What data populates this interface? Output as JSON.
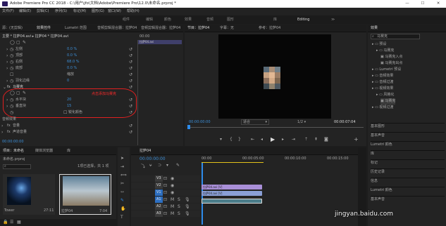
{
  "title_bar": {
    "title": "Adobe Premiere Pro CC 2018 - C:\\用户\\jfo\\文档\\Adobe\\Premiere Pro\\12.0\\未命名.prproj *",
    "min": "—",
    "max": "☐",
    "close": "✕"
  },
  "menu": [
    "文件(F)",
    "编辑(E)",
    "剪辑(C)",
    "序列(S)",
    "标记(M)",
    "图形(G)",
    "窗口(W)",
    "帮助(H)"
  ],
  "workspaces": [
    "组件",
    "编辑",
    "颜色",
    "效果",
    "音频",
    "图形",
    "库",
    "Editing",
    "≫"
  ],
  "source_panel": {
    "tabs": [
      "源：(无剪辑)",
      "效果控件",
      "Lumetri 范围",
      "音频剪辑混合器：拉萨04",
      "音频剪辑混合器：拉萨04"
    ],
    "clip_path": "主要 * 拉萨04.avi ▸ 拉萨04 * 拉萨04.avi",
    "ruler_time": "00:00",
    "ruler_clip": "拉萨04.avi",
    "params": [
      {
        "name": "左侧",
        "value": "0.0 %"
      },
      {
        "name": "顶部",
        "value": "0.0 %"
      },
      {
        "name": "右侧",
        "value": "68.0 %"
      },
      {
        "name": "底部",
        "value": "0.0 %"
      },
      {
        "name": "羽化边缘",
        "value": "0"
      }
    ],
    "zoom_label": "缩放",
    "mosaic_title": "马赛克",
    "mosaic_params": [
      {
        "name": "水平块",
        "value": "20"
      },
      {
        "name": "垂直块",
        "value": "15"
      }
    ],
    "sharpen_label": "锐化颜色",
    "annotation": "点击添加马赛克",
    "audio_effects": "音频效果",
    "volume": "音量",
    "channel_volume": "声道音量",
    "timecode": "00:00:00:00"
  },
  "program_panel": {
    "tabs": [
      "节目：拉萨04",
      "字幕：无",
      "参考：拉萨04"
    ],
    "timecode_left": "00:00:00:00",
    "fit": "适合",
    "quality": "1/2",
    "timecode_right": "00:00:07:04"
  },
  "effects_panel": {
    "tab": "效果",
    "search_value": "马赛克",
    "tree": [
      {
        "label": "预设",
        "indent": 0
      },
      {
        "label": "马赛克",
        "indent": 1
      },
      {
        "label": "马赛克入点",
        "indent": 2
      },
      {
        "label": "马赛克出点",
        "indent": 2
      },
      {
        "label": "Lumetri 预设",
        "indent": 0
      },
      {
        "label": "音频效果",
        "indent": 0
      },
      {
        "label": "音频过渡",
        "indent": 0
      },
      {
        "label": "视频效果",
        "indent": 0
      },
      {
        "label": "风格化",
        "indent": 1
      },
      {
        "label": "马赛克",
        "indent": 2
      },
      {
        "label": "视频过渡",
        "indent": 0
      }
    ],
    "sections": [
      "基本图形",
      "基本声音",
      "Lumetri 颜色",
      "库",
      "标记",
      "历史记录",
      "信息",
      "Lumetri 颜色",
      "基本声音"
    ]
  },
  "project_panel": {
    "tabs": [
      "项目：未命名",
      "媒体浏览器",
      "库"
    ],
    "project_file": "未命名.prproj",
    "selection_info": "1项已选择，共 1 项",
    "search_placeholder": "",
    "clips": [
      {
        "name": "Tower",
        "duration": "27:11"
      },
      {
        "name": "拉萨04",
        "duration": "7:04"
      }
    ]
  },
  "timeline": {
    "tab": "拉萨04",
    "timecode": "00:00:00:00",
    "ruler": [
      "00:00",
      "00:00:05:00",
      "00:00:10:00",
      "00:00:15:00"
    ],
    "tracks": [
      "V3",
      "V2",
      "V1",
      "A1",
      "A2",
      "A3"
    ],
    "clips": [
      {
        "label": "拉萨04.avi [V]",
        "color": "#a98fd8"
      },
      {
        "label": "拉萨04.avi [V]",
        "color": "#8a9fd6"
      },
      {
        "label": "",
        "color": "#4b7d8a"
      }
    ]
  },
  "watermark": "jingyan.baidu.com"
}
